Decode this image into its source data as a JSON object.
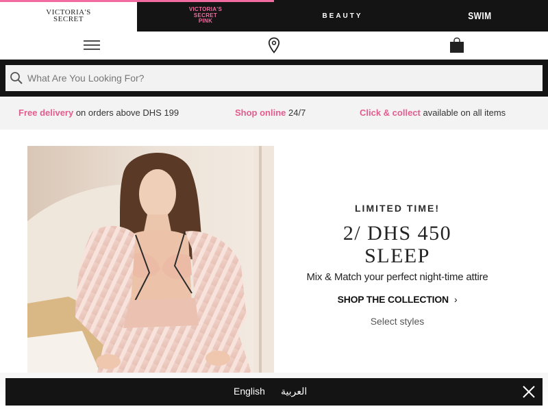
{
  "brands": {
    "victorias_secret": [
      "VICTORIA'S",
      "SECRET"
    ],
    "pink": [
      "VICTORIA'S",
      "SECRET",
      "PINK"
    ],
    "beauty": "BEAUTY",
    "swim": "SWIM"
  },
  "icons": {
    "menu": "hamburger-icon",
    "store_locator": "location-pin-icon",
    "bag": "shopping-bag-icon",
    "search": "search-icon",
    "close": "close-icon",
    "chevron": "›"
  },
  "search": {
    "placeholder": "What Are You Looking For?"
  },
  "promos": [
    {
      "highlight": "Free delivery",
      "text": " on orders above DHS 199"
    },
    {
      "highlight": "Shop online",
      "text": " 24/7"
    },
    {
      "highlight": "Click & collect",
      "text": " available on all items"
    }
  ],
  "hero": {
    "eyebrow": "LIMITED TIME!",
    "headline_1": "2/ DHS 450",
    "headline_2": "SLEEP",
    "subline": "Mix & Match your perfect night-time attire",
    "cta": "SHOP THE COLLECTION",
    "note": "Select styles"
  },
  "language": {
    "english": "English",
    "arabic": "العربية"
  },
  "colors": {
    "accent_pink": "#f06ca0",
    "promo_pink": "#e35c8f",
    "dark": "#141414"
  }
}
